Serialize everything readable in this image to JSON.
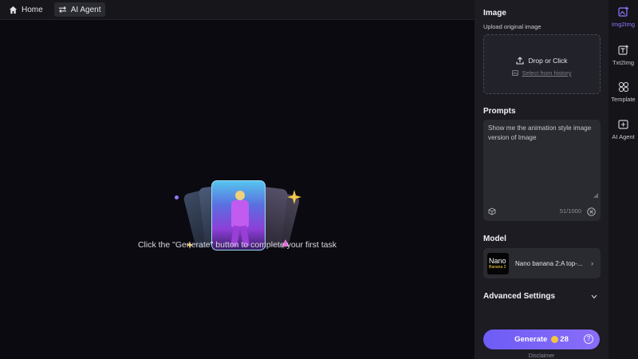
{
  "topbar": {
    "home_label": "Home",
    "agent_label": "AI Agent"
  },
  "canvas": {
    "empty_message": "Click the \"Generate\" button to complete your first task"
  },
  "panel": {
    "image_title": "Image",
    "upload_label": "Upload original image",
    "drop_label": "Drop or Click",
    "history_label": "Select from history",
    "prompts_title": "Prompts",
    "prompt_text": "Show me the animation style image version of Image",
    "prompt_count": "51/1000",
    "model_title": "Model",
    "model_thumb_line1": "Nano",
    "model_thumb_line2": "Banana 2",
    "model_name": "Nano banana 2:A top-...",
    "advanced_title": "Advanced Settings",
    "generate_label": "Generate",
    "generate_cost": "28",
    "disclaimer": "Disclaimer"
  },
  "rail": {
    "items": [
      {
        "label": "Img2Img",
        "icon": "image-plus-icon",
        "active": true
      },
      {
        "label": "Txt2Img",
        "icon": "text-image-icon",
        "active": false
      },
      {
        "label": "Template",
        "icon": "grid-icon",
        "active": false
      },
      {
        "label": "AI Agent",
        "icon": "agent-frame-icon",
        "active": false
      }
    ]
  },
  "colors": {
    "accent": "#7b66f7",
    "panel_bg": "#1c1c22",
    "canvas_bg": "#0b0a10"
  }
}
